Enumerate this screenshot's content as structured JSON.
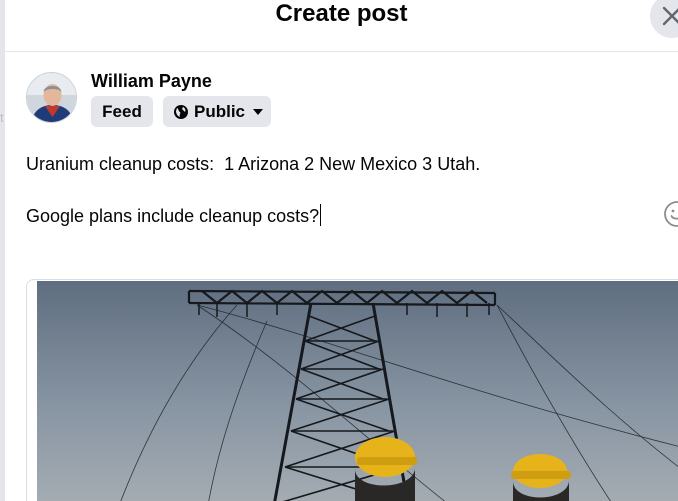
{
  "dialog": {
    "title": "Create post"
  },
  "author": {
    "name": "William Payne"
  },
  "audience": {
    "feed_label": "Feed",
    "privacy_label": "Public"
  },
  "post": {
    "line1": "Uranium cleanup costs:  1 Arizona 2 New Mexico 3 Utah.",
    "line2": "Google plans include cleanup costs?"
  },
  "background_hint": "t",
  "icons": {
    "close": "close-icon",
    "globe": "globe-icon",
    "dropdown": "caret-down-icon",
    "emoji": "emoji-icon"
  },
  "colors": {
    "chip_bg": "#e4e6eb",
    "text": "#050505",
    "helmet": "#e6b41a"
  }
}
